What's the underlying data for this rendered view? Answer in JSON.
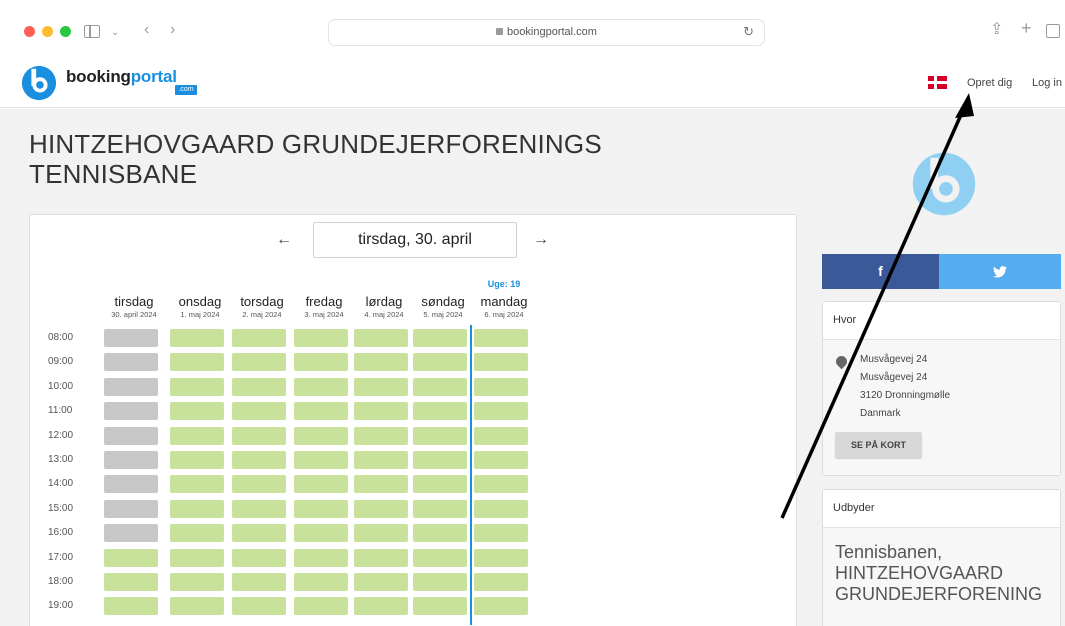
{
  "browser": {
    "url": "bookingportal.com"
  },
  "header": {
    "logo_text_main": "booking",
    "logo_text_accent": "portal",
    "logo_com": ".com",
    "signup_label": "Opret dig",
    "login_label": "Log in"
  },
  "page": {
    "title_line1": "HINTZEHOVGAARD GRUNDEJERFORENINGS",
    "title_line2": "TENNISBANE"
  },
  "calendar": {
    "prev_arrow": "←",
    "next_arrow": "→",
    "selected_date": "tirsdag, 30. april",
    "week_label": "Uge: 19",
    "days": [
      {
        "name": "tirsdag",
        "date": "30. april 2024"
      },
      {
        "name": "onsdag",
        "date": "1. maj 2024"
      },
      {
        "name": "torsdag",
        "date": "2. maj 2024"
      },
      {
        "name": "fredag",
        "date": "3. maj 2024"
      },
      {
        "name": "lørdag",
        "date": "4. maj 2024"
      },
      {
        "name": "søndag",
        "date": "5. maj 2024"
      },
      {
        "name": "mandag",
        "date": "6. maj 2024"
      }
    ],
    "times": [
      "08:00",
      "09:00",
      "10:00",
      "11:00",
      "12:00",
      "13:00",
      "14:00",
      "15:00",
      "16:00",
      "17:00",
      "18:00",
      "19:00"
    ],
    "past_slots_first_day_count": 9,
    "colors": {
      "free": "#c8e29c",
      "past": "#c7c7c7",
      "week_line": "#1a8fe0"
    }
  },
  "social": {
    "facebook": "f",
    "twitter": "🐦"
  },
  "location": {
    "heading": "Hvor",
    "lines": [
      "Musvågevej 24",
      "Musvågevej 24",
      "3120 Dronningmølle",
      "Danmark"
    ],
    "map_button": "SE PÅ KORT"
  },
  "provider": {
    "heading": "Udbyder",
    "name_line1": "Tennisbanen,",
    "name_line2": "HINTZEHOVGAARD",
    "name_line3": "GRUNDEJERFORENING"
  },
  "colors": {
    "brand": "#1a8fe0",
    "facebook": "#3b5998",
    "twitter": "#55acee"
  }
}
